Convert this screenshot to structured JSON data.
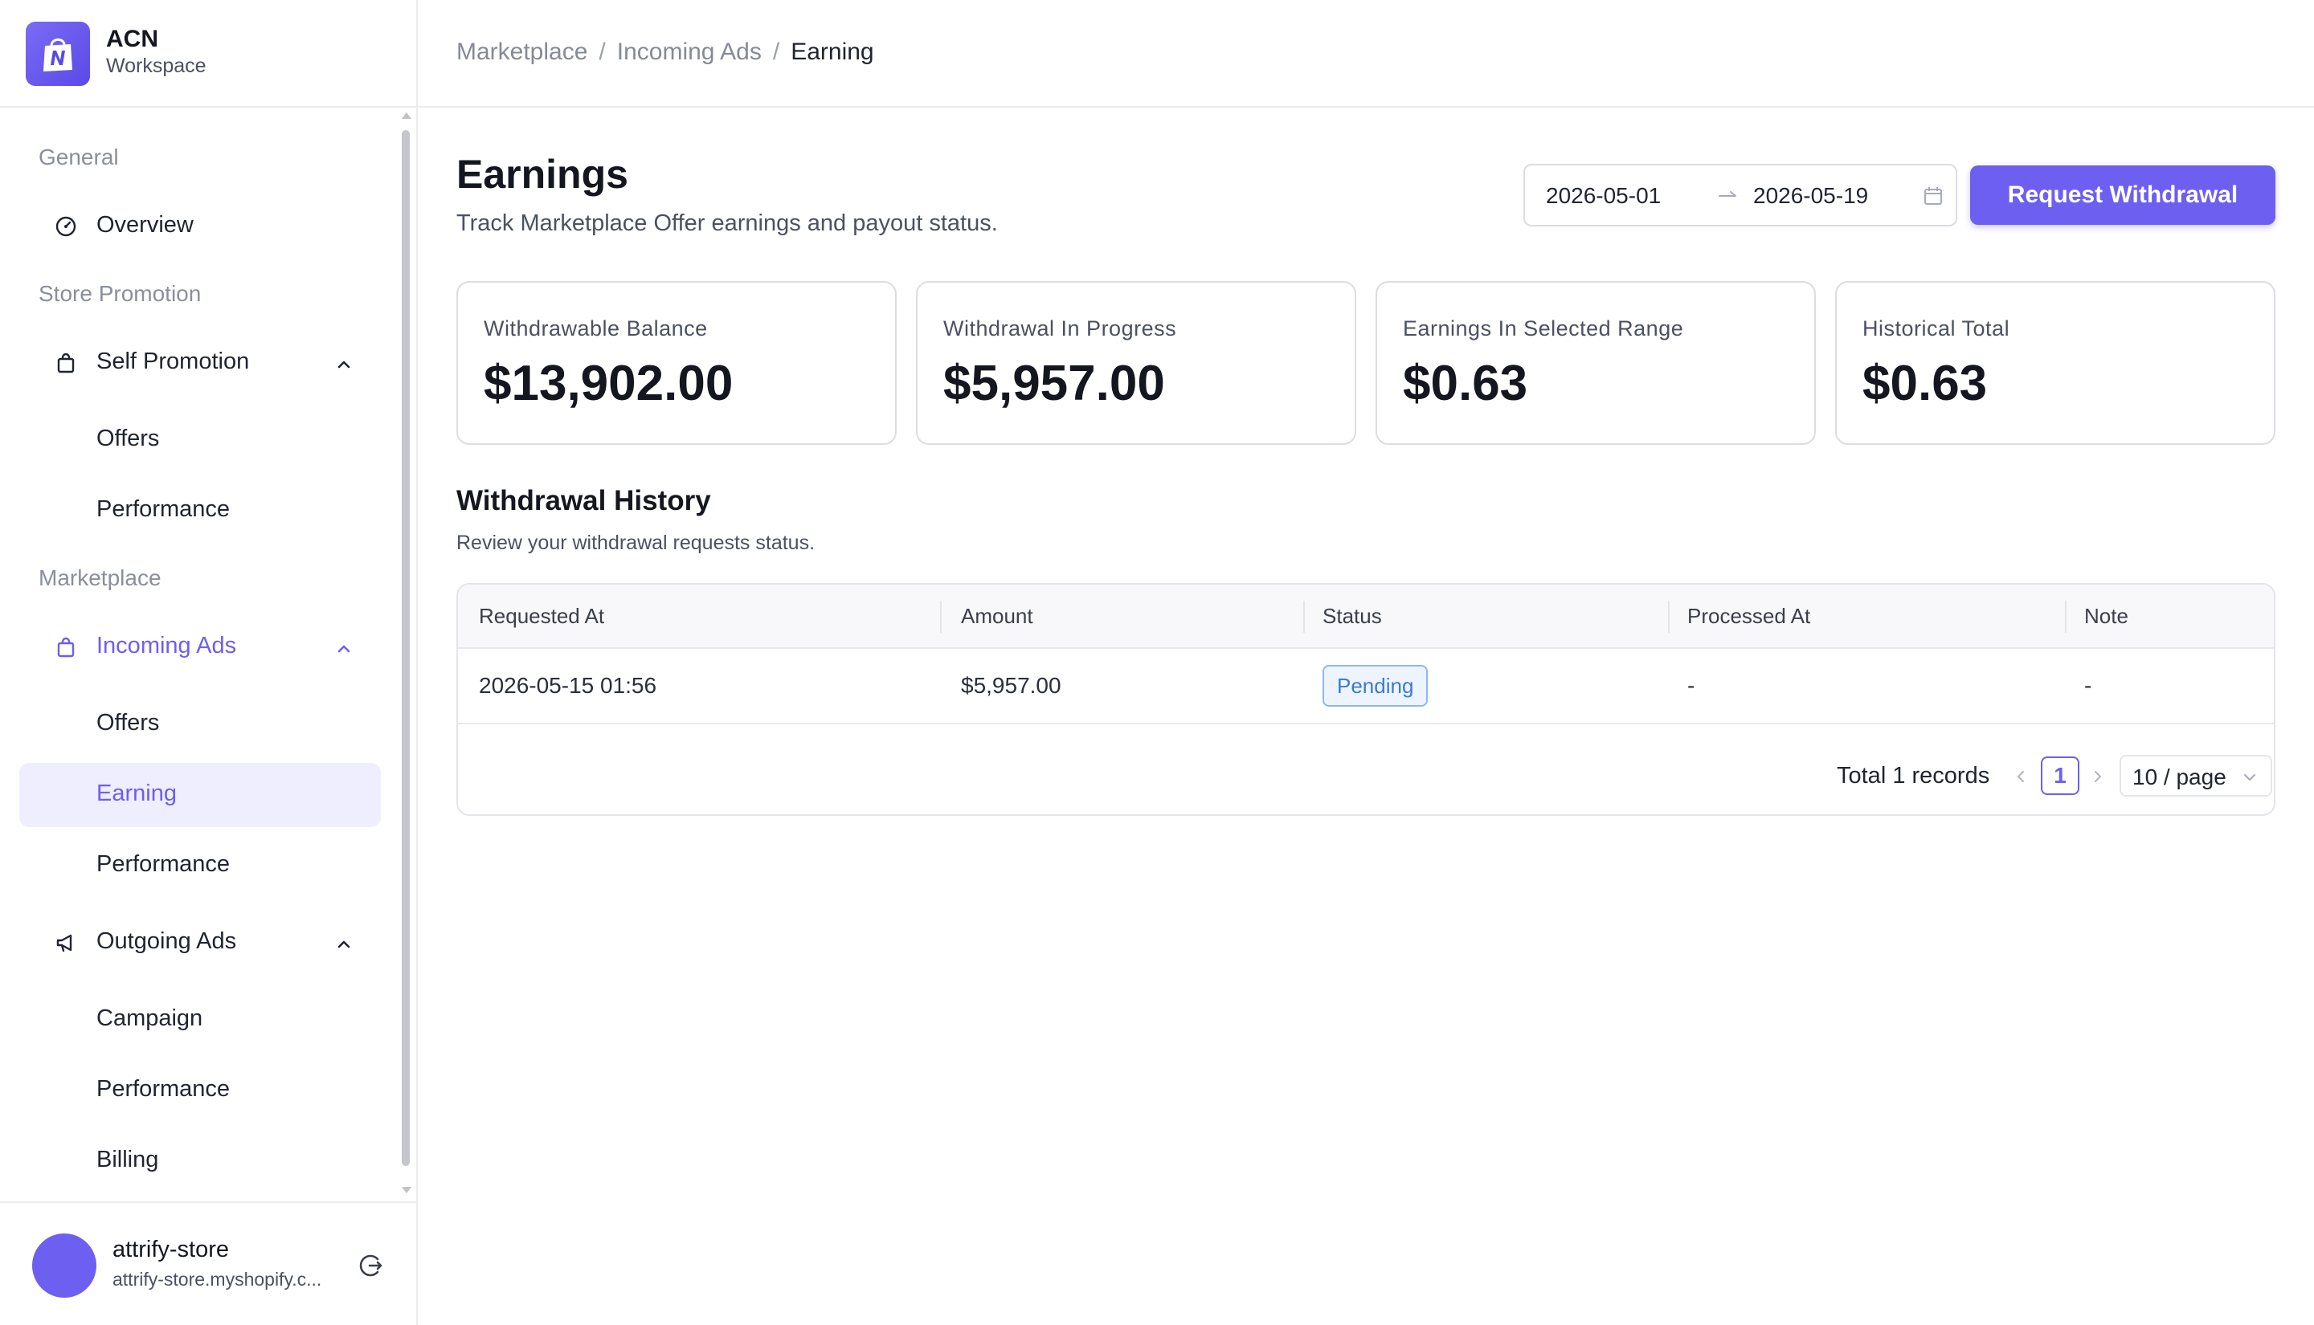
{
  "brand": {
    "name": "ACN",
    "subtitle": "Workspace",
    "accent": "#6d5ff0"
  },
  "sidebar": {
    "sections": {
      "general": "General",
      "store_promotion": "Store Promotion",
      "marketplace": "Marketplace"
    },
    "items": {
      "overview": "Overview",
      "self_promotion": "Self Promotion",
      "self_offers": "Offers",
      "self_performance": "Performance",
      "incoming_ads": "Incoming Ads",
      "incoming_offers": "Offers",
      "incoming_earning": "Earning",
      "incoming_performance": "Performance",
      "outgoing_ads": "Outgoing Ads",
      "outgoing_campaign": "Campaign",
      "outgoing_performance": "Performance",
      "outgoing_billing": "Billing"
    }
  },
  "user": {
    "name": "attrify-store",
    "domain": "attrify-store.myshopify.c..."
  },
  "breadcrumb": {
    "level1": "Marketplace",
    "level2": "Incoming Ads",
    "current": "Earning",
    "sep": "/"
  },
  "page": {
    "title": "Earnings",
    "subtitle": "Track Marketplace Offer earnings and payout status."
  },
  "date_range": {
    "start": "2026-05-01",
    "end": "2026-05-19"
  },
  "actions": {
    "withdraw_label": "Request Withdrawal"
  },
  "cards": [
    {
      "label": "Withdrawable Balance",
      "value": "$13,902.00"
    },
    {
      "label": "Withdrawal In Progress",
      "value": "$5,957.00"
    },
    {
      "label": "Earnings In Selected Range",
      "value": "$0.63"
    },
    {
      "label": "Historical Total",
      "value": "$0.63"
    }
  ],
  "history": {
    "title": "Withdrawal History",
    "subtitle": "Review your withdrawal requests status.",
    "columns": [
      "Requested At",
      "Amount",
      "Status",
      "Processed At",
      "Note"
    ],
    "rows": [
      {
        "requested_at": "2026-05-15 01:56",
        "amount": "$5,957.00",
        "status": "Pending",
        "processed_at": "-",
        "note": "-"
      }
    ],
    "status_color": "#3a7bd5"
  },
  "pagination": {
    "total": "Total 1 records",
    "current_page": "1",
    "page_size": "10 / page"
  }
}
